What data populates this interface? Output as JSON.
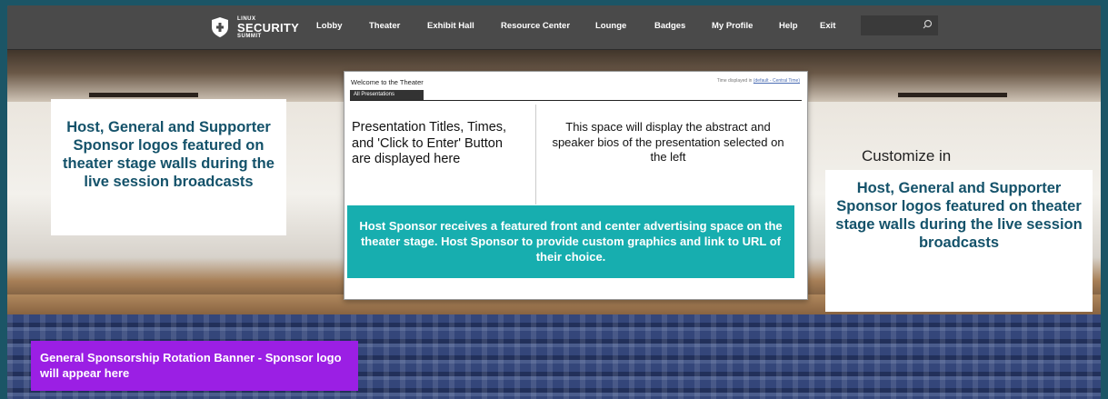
{
  "nav": {
    "logo": {
      "line1": "LINUX",
      "line2": "SECURITY",
      "line3": "SUMMIT"
    },
    "items": [
      "Lobby",
      "Theater",
      "Exhibit Hall",
      "Resource Center",
      "Lounge",
      "Badges",
      "My Profile",
      "Help",
      "Exit"
    ],
    "search_placeholder": ""
  },
  "panel": {
    "title": "Welcome to the Theater",
    "timezone_prefix": "Time displayed in",
    "timezone_link": "(default - Central Time)",
    "tab_label": "All Presentations",
    "left_text": "Presentation Titles, Times, and 'Click to Enter' Button are displayed here",
    "right_text": "This space will display the abstract and speaker bios of the presentation selected on the left"
  },
  "sponsors": {
    "left_box": "Host, General and Supporter Sponsor logos featured on theater stage walls during the live session broadcasts",
    "right_box": "Host, General and Supporter Sponsor logos featured on theater stage walls during the live session broadcasts",
    "host_box": "Host Sponsor receives a featured front and center advertising space on the theater stage. Host Sponsor to provide custom graphics and link to URL of their choice.",
    "customize": "Customize in",
    "rotation_banner": "General Sponsorship Rotation Banner - Sponsor logo will appear here"
  },
  "colors": {
    "navbar": "#4a4a4a",
    "sponsor_text": "#14526a",
    "host_box": "#17aeaf",
    "banner": "#9b1fe4",
    "outer_bg": "#1b5566"
  }
}
